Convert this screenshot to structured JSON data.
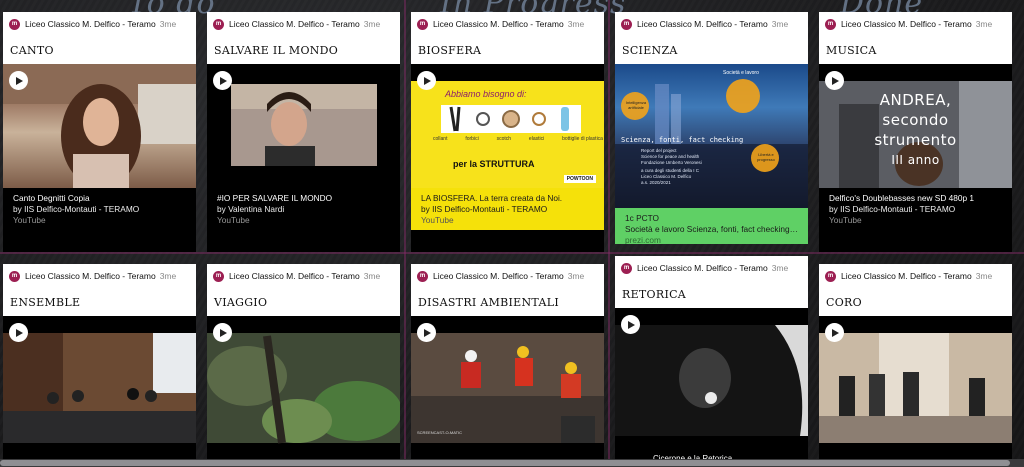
{
  "board": {
    "columns": [
      "To do",
      "In Progress",
      "Done"
    ]
  },
  "author_initial": "m",
  "cards": [
    {
      "author": "Liceo Classico M. Delfico - Teramo",
      "time": "3me",
      "title": "CANTO",
      "caption": "Canto Degnitti Copia",
      "sub": "by IIS Delfico-Montauti - TERAMO",
      "source": "YouTube"
    },
    {
      "author": "Liceo Classico M. Delfico - Teramo",
      "time": "3me",
      "title": "SALVARE IL MONDO",
      "caption": "#IO PER SALVARE IL MONDO",
      "sub": "by Valentina Nardi",
      "source": "YouTube"
    },
    {
      "author": "Liceo Classico M. Delfico - Teramo",
      "time": "3me",
      "title": "BIOSFERA",
      "caption": "LA BIOSFERA. La terra creata da Noi.",
      "sub": "by IIS Delfico-Montauti - TERAMO",
      "source": "YouTube",
      "poster": {
        "heading": "Abbiamo bisogno di:",
        "items": [
          "collant",
          "forbici",
          "scotch",
          "elastici",
          "bottiglie di plastica"
        ],
        "footer": "per la STRUTTURA",
        "brand": "POWTOON"
      }
    },
    {
      "author": "Liceo Classico M. Delfico - Teramo",
      "time": "3me",
      "title": "SCIENZA",
      "caption": "1c PCTO",
      "sub": "Società e lavoro Scienza, fonti, fact checking R...",
      "source": "prezi.com",
      "poster": {
        "top": "Società e lavoro",
        "bubble1": "Intelligenza artificiale",
        "bubble2": "Libertà e progresso",
        "line1": "Scienza, fonti, fact checking",
        "line2": "Report del project",
        "line3": "Science for peace and health",
        "line4": "Fondazione Umberto Veronesi",
        "line5": "a cura degli studenti della I C",
        "line6": "Liceo Classico M. Delfico",
        "line7": "a.s. 2020/2021"
      }
    },
    {
      "author": "Liceo Classico M. Delfico - Teramo",
      "time": "3me",
      "title": "MUSICA",
      "caption": "Delfico's Doublebasses new SD 480p 1",
      "sub": "by IIS Delfico-Montauti - TERAMO",
      "source": "YouTube",
      "overlay": [
        "ANDREA,",
        "secondo",
        "strumento",
        "III anno"
      ]
    },
    {
      "author": "Liceo Classico M. Delfico - Teramo",
      "time": "3me",
      "title": "ENSEMBLE"
    },
    {
      "author": "Liceo Classico M. Delfico - Teramo",
      "time": "3me",
      "title": "VIAGGIO"
    },
    {
      "author": "Liceo Classico M. Delfico - Teramo",
      "time": "3me",
      "title": "DISASTRI AMBIENTALI",
      "poster": {
        "brand": "SCREENCAST-O-MATIC"
      }
    },
    {
      "author": "Liceo Classico M. Delfico - Teramo",
      "time": "3me",
      "title": "RETORICA",
      "caption": "Cicerone e la Retorica"
    },
    {
      "author": "Liceo Classico M. Delfico - Teramo",
      "time": "3me",
      "title": "CORO"
    }
  ],
  "colors": {
    "accent": "#9c1f52",
    "board": "#1e1e20",
    "yellow": "#f5e10a",
    "green": "#5fd065"
  }
}
